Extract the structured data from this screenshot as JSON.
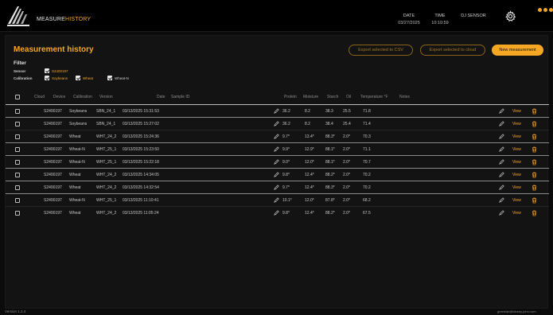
{
  "nav": {
    "measure_label": "MEASURE",
    "history_label": "HISTORY"
  },
  "status": {
    "date_label": "DATE",
    "date_value": "03/27/2025",
    "time_label": "TIME",
    "time_value": "10:10:59",
    "sensor_label": "DJ SENSOR",
    "sensor_value": ""
  },
  "page": {
    "title": "Measurement history",
    "export_csv_label": "Export selected to CSV",
    "export_cloud_label": "Export selected to cloud",
    "new_measurement_label": "New measurement"
  },
  "filter": {
    "title": "Filter",
    "sensor_label": "Sensor",
    "sensor_value": "S2400197",
    "calibration_label": "Calibration",
    "calibrations": [
      "Soybeans",
      "Wheat",
      "Wheat-N"
    ]
  },
  "table": {
    "columns": {
      "cloud": "Cloud",
      "device": "Device",
      "calibration": "Calibration",
      "version": "Version",
      "date": "Date",
      "sample_id": "Sample ID",
      "protein": "Protein",
      "moisture": "Moisture",
      "starch": "Starch",
      "oil": "Oil",
      "temperature": "Temperature °F",
      "notes": "Notes"
    },
    "view_label": "View",
    "rows": [
      {
        "device": "S2400197",
        "calibration": "Soybeans",
        "version": "SBN_24_1",
        "date": "03/13/2025 15:31:53",
        "protein": "36.2",
        "moisture": "8.2",
        "starch": "38.3",
        "oil": "25.5",
        "temperature": "71.8"
      },
      {
        "device": "S2400197",
        "calibration": "Soybeans",
        "version": "SBN_24_1",
        "date": "03/13/2025 15:27:02",
        "protein": "36.2",
        "moisture": "8.2",
        "starch": "38.4",
        "oil": "25.4",
        "temperature": "71.4"
      },
      {
        "device": "S2400197",
        "calibration": "Wheat",
        "version": "WHT_24_2",
        "date": "03/13/2025 15:24:36",
        "protein": "9.7*",
        "moisture": "13.4*",
        "starch": "88.3*",
        "oil": "2.0*",
        "temperature": "70.3"
      },
      {
        "device": "S2400197",
        "calibration": "Wheat-N",
        "version": "WHT_25_1",
        "date": "03/13/2025 15:23:50",
        "protein": "9.9*",
        "moisture": "12.9*",
        "starch": "88.1*",
        "oil": "2.0*",
        "temperature": "71.1"
      },
      {
        "device": "S2400197",
        "calibration": "Wheat-N",
        "version": "WHT_25_1",
        "date": "03/13/2025 15:22:18",
        "protein": "9.0*",
        "moisture": "12.0*",
        "starch": "88.1*",
        "oil": "2.0*",
        "temperature": "70.7"
      },
      {
        "device": "S2400197",
        "calibration": "Wheat",
        "version": "WHT_24_2",
        "date": "03/13/2025 14:34:05",
        "protein": "9.8*",
        "moisture": "12.4*",
        "starch": "88.2*",
        "oil": "2.0*",
        "temperature": "70.2"
      },
      {
        "device": "S2400197",
        "calibration": "Wheat",
        "version": "WHT_24_2",
        "date": "03/13/2025 14:32:54",
        "protein": "9.7*",
        "moisture": "12.4*",
        "starch": "88.3*",
        "oil": "2.0*",
        "temperature": "70.2"
      },
      {
        "device": "S2400197",
        "calibration": "Wheat-N",
        "version": "WHT_25_1",
        "date": "03/13/2025 11:10:41",
        "protein": "10.1*",
        "moisture": "12.0*",
        "starch": "87.8*",
        "oil": "2.0*",
        "temperature": "68.2"
      },
      {
        "device": "S2400197",
        "calibration": "Wheat",
        "version": "WHT_24_2",
        "date": "03/13/2025 11:05:24",
        "protein": "9.8*",
        "moisture": "12.4*",
        "starch": "88.2*",
        "oil": "2.0*",
        "temperature": "67.5"
      }
    ]
  },
  "footer": {
    "version": "Version 1.2.4",
    "user": "greenlab@dickey-john.com"
  },
  "colors": {
    "accent": "#f5a623",
    "background": "#0b0b0b",
    "panel": "#131313"
  },
  "icons": [
    "app-logo-icon",
    "gear-icon",
    "pencil-icon",
    "trash-icon",
    "checkbox-icon"
  ]
}
